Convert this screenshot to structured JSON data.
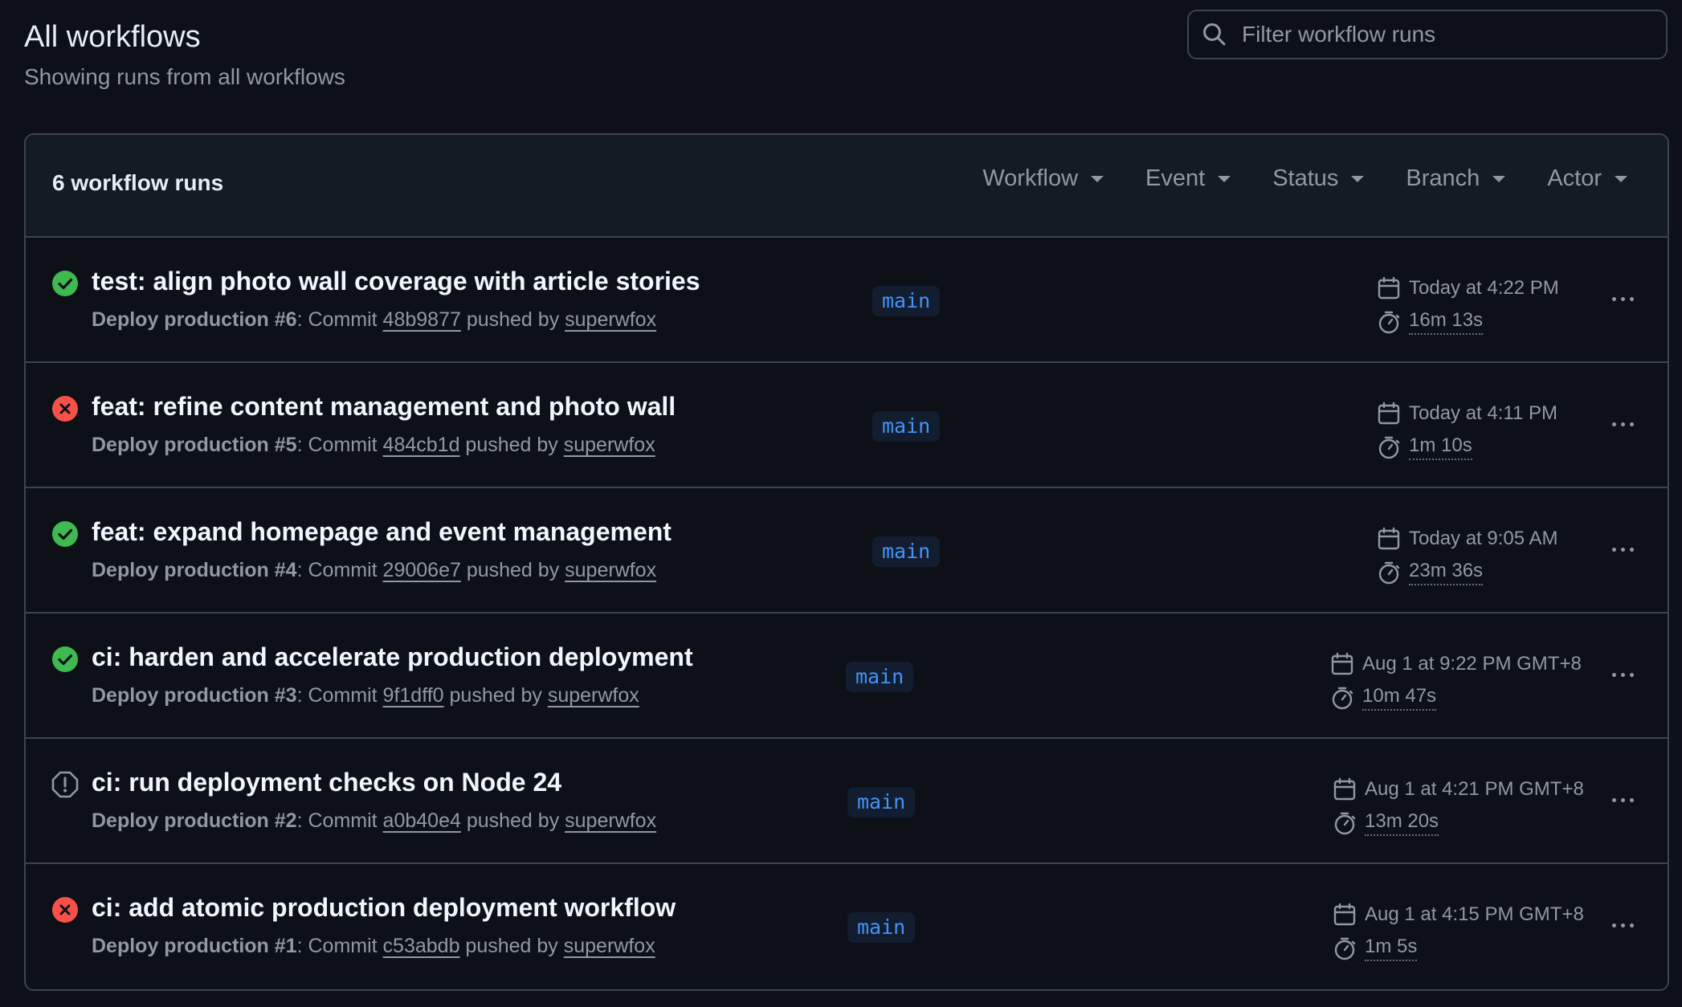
{
  "header": {
    "title": "All workflows",
    "subtitle": "Showing runs from all workflows"
  },
  "search": {
    "placeholder": "Filter workflow runs",
    "icon": "search-icon"
  },
  "list": {
    "count_label": "6 workflow runs",
    "filters": [
      "Workflow",
      "Event",
      "Status",
      "Branch",
      "Actor"
    ]
  },
  "colors": {
    "success": "#3fb950",
    "failure": "#f85149",
    "neutral": "#9198a1",
    "branch": "#4493f8"
  },
  "runs": [
    {
      "status": "success",
      "title": "test: align photo wall coverage with article stories",
      "workflow": "Deploy production #6",
      "commit_prefix": ": Commit ",
      "commit": "48b9877",
      "pushed_by": " pushed by ",
      "actor": "superwfox",
      "branch": "main",
      "time": "Today at 4:22 PM",
      "duration": "16m 13s"
    },
    {
      "status": "failure",
      "title": "feat: refine content management and photo wall",
      "workflow": "Deploy production #5",
      "commit_prefix": ": Commit ",
      "commit": "484cb1d",
      "pushed_by": " pushed by ",
      "actor": "superwfox",
      "branch": "main",
      "time": "Today at 4:11 PM",
      "duration": "1m 10s"
    },
    {
      "status": "success",
      "title": "feat: expand homepage and event management",
      "workflow": "Deploy production #4",
      "commit_prefix": ": Commit ",
      "commit": "29006e7",
      "pushed_by": " pushed by ",
      "actor": "superwfox",
      "branch": "main",
      "time": "Today at 9:05 AM",
      "duration": "23m 36s"
    },
    {
      "status": "success",
      "title": "ci: harden and accelerate production deployment",
      "workflow": "Deploy production #3",
      "commit_prefix": ": Commit ",
      "commit": "9f1dff0",
      "pushed_by": " pushed by ",
      "actor": "superwfox",
      "branch": "main",
      "time": "Aug 1 at 9:22 PM GMT+8",
      "duration": "10m 47s"
    },
    {
      "status": "neutral",
      "title": "ci: run deployment checks on Node 24",
      "workflow": "Deploy production #2",
      "commit_prefix": ": Commit ",
      "commit": "a0b40e4",
      "pushed_by": " pushed by ",
      "actor": "superwfox",
      "branch": "main",
      "time": "Aug 1 at 4:21 PM GMT+8",
      "duration": "13m 20s"
    },
    {
      "status": "failure",
      "title": "ci: add atomic production deployment workflow",
      "workflow": "Deploy production #1",
      "commit_prefix": ": Commit ",
      "commit": "c53abdb",
      "pushed_by": " pushed by ",
      "actor": "superwfox",
      "branch": "main",
      "time": "Aug 1 at 4:15 PM GMT+8",
      "duration": "1m 5s"
    }
  ]
}
